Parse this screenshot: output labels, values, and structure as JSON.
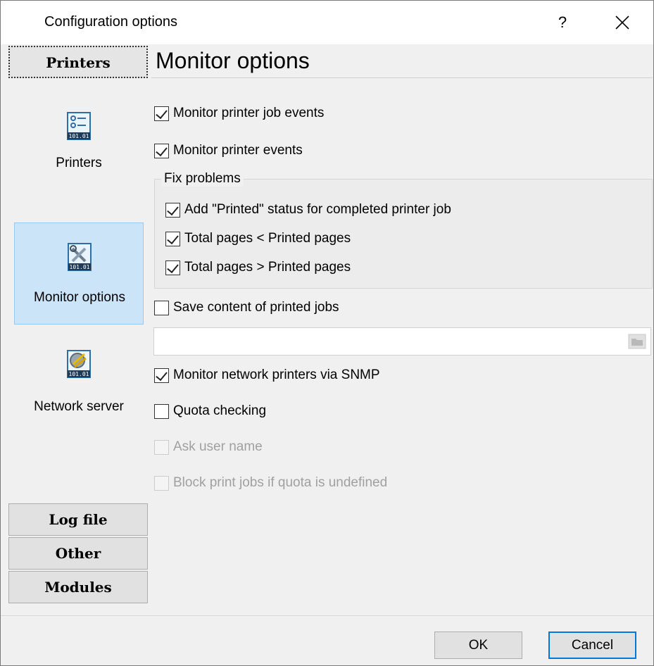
{
  "window": {
    "title": "Configuration options",
    "help": "?"
  },
  "sidebar": {
    "groups_top": [
      {
        "label": "Printers",
        "active": true
      }
    ],
    "items": [
      {
        "label": "Printers",
        "icon": "printers-config-icon"
      },
      {
        "label": "Monitor options",
        "icon": "monitor-tools-icon"
      },
      {
        "label": "Network server",
        "icon": "network-server-icon"
      }
    ],
    "groups_bottom": [
      {
        "label": "Log file"
      },
      {
        "label": "Other"
      },
      {
        "label": "Modules"
      }
    ]
  },
  "main": {
    "title": "Monitor options",
    "options": {
      "job_events": {
        "label": "Monitor printer job events",
        "checked": true
      },
      "printer_events": {
        "label": "Monitor printer events",
        "checked": true
      },
      "fix_problems": {
        "legend": "Fix problems",
        "printed_status": {
          "label": "Add \"Printed\" status for completed printer job",
          "checked": true
        },
        "total_lt_printed": {
          "label": "Total pages < Printed pages",
          "checked": true
        },
        "total_gt_printed": {
          "label": "Total pages > Printed pages",
          "checked": true
        }
      },
      "save_content": {
        "label": "Save content of printed jobs",
        "checked": false
      },
      "save_path": {
        "value": ""
      },
      "snmp": {
        "label": "Monitor network printers via SNMP",
        "checked": true
      },
      "quota": {
        "label": "Quota checking",
        "checked": false
      },
      "ask_user": {
        "label": "Ask user name",
        "checked": false,
        "disabled": true
      },
      "block_jobs": {
        "label": "Block print jobs if quota is undefined",
        "checked": false,
        "disabled": true
      }
    }
  },
  "footer": {
    "ok": "OK",
    "cancel": "Cancel"
  },
  "colors": {
    "selection_bg": "#cce4f7",
    "selection_border": "#99c9ef",
    "default_button_border": "#0078d7"
  }
}
